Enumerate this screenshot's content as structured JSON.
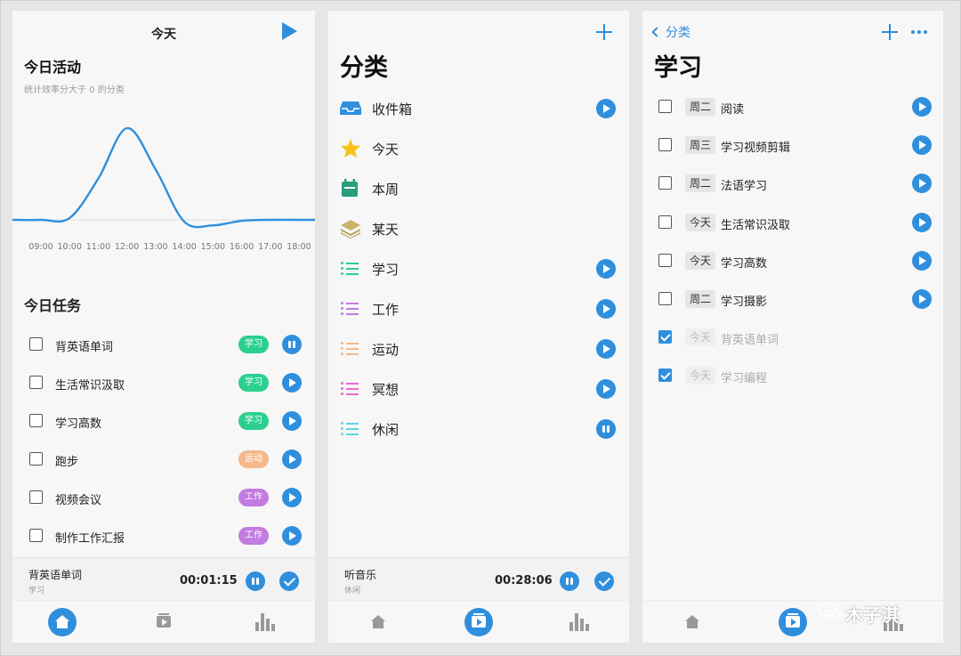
{
  "colors": {
    "accent": "#2f8fdd",
    "study": "#2dcf8f",
    "sport": "#f5b88a",
    "work": "#c27be0"
  },
  "panel1": {
    "header_title": "今天",
    "activity_title": "今日活动",
    "activity_sub": "统计效率分大于 0 的分类",
    "chart_data": {
      "type": "line",
      "categories": [
        "09:00",
        "10:00",
        "11:00",
        "12:00",
        "13:00",
        "14:00",
        "15:00",
        "16:00",
        "17:00",
        "18:00"
      ],
      "x": [
        "09:00",
        "10:00",
        "11:00",
        "12:00",
        "13:00",
        "14:00",
        "15:00",
        "16:00",
        "17:00",
        "18:00"
      ],
      "series": [
        {
          "values": [
            0,
            0.02,
            0.45,
            1.0,
            0.55,
            -0.02,
            -0.06,
            -0.01,
            0,
            0
          ]
        }
      ],
      "xlabel": "",
      "ylabel": "",
      "grid": false
    },
    "tasks_title": "今日任务",
    "tasks": [
      {
        "label": "背英语单词",
        "tag": "学习",
        "tag_color": "#2dcf8f",
        "state": "pause"
      },
      {
        "label": "生活常识汲取",
        "tag": "学习",
        "tag_color": "#2dcf8f",
        "state": "play"
      },
      {
        "label": "学习高数",
        "tag": "学习",
        "tag_color": "#2dcf8f",
        "state": "play"
      },
      {
        "label": "跑步",
        "tag": "运动",
        "tag_color": "#f5b88a",
        "state": "play"
      },
      {
        "label": "视频会议",
        "tag": "工作",
        "tag_color": "#c27be0",
        "state": "play"
      },
      {
        "label": "制作工作汇报",
        "tag": "工作",
        "tag_color": "#c27be0",
        "state": "play"
      }
    ],
    "current": {
      "title": "背英语单词",
      "category": "学习",
      "time": "00:01:15"
    }
  },
  "panel2": {
    "title": "分类",
    "categories": [
      {
        "label": "收件箱",
        "icon": "inbox-icon"
      },
      {
        "label": "今天",
        "icon": "star-icon"
      },
      {
        "label": "本周",
        "icon": "calendar-icon"
      },
      {
        "label": "某天",
        "icon": "layers-icon"
      },
      {
        "label": "学习",
        "icon": "list-icon",
        "color": "#2dcf8f"
      },
      {
        "label": "工作",
        "icon": "list-icon",
        "color": "#c27be0"
      },
      {
        "label": "运动",
        "icon": "list-icon",
        "color": "#f5b88a"
      },
      {
        "label": "冥想",
        "icon": "list-icon",
        "color": "#e86ad0"
      },
      {
        "label": "休闲",
        "icon": "list-icon",
        "color": "#5fd3e0"
      }
    ],
    "current": {
      "title": "听音乐",
      "category": "休闲",
      "time": "00:28:06"
    }
  },
  "panel3": {
    "back_label": "分类",
    "title": "学习",
    "tasks": [
      {
        "day": "周二",
        "label": "阅读",
        "done": false
      },
      {
        "day": "周三",
        "label": "学习视频剪辑",
        "done": false
      },
      {
        "day": "周二",
        "label": "法语学习",
        "done": false
      },
      {
        "day": "今天",
        "label": "生活常识汲取",
        "done": false
      },
      {
        "day": "今天",
        "label": "学习高数",
        "done": false
      },
      {
        "day": "周二",
        "label": "学习摄影",
        "done": false
      },
      {
        "day": "今天",
        "label": "背英语单词",
        "done": true
      },
      {
        "day": "今天",
        "label": "学习编程",
        "done": true
      }
    ]
  },
  "watermark": "木子淇"
}
